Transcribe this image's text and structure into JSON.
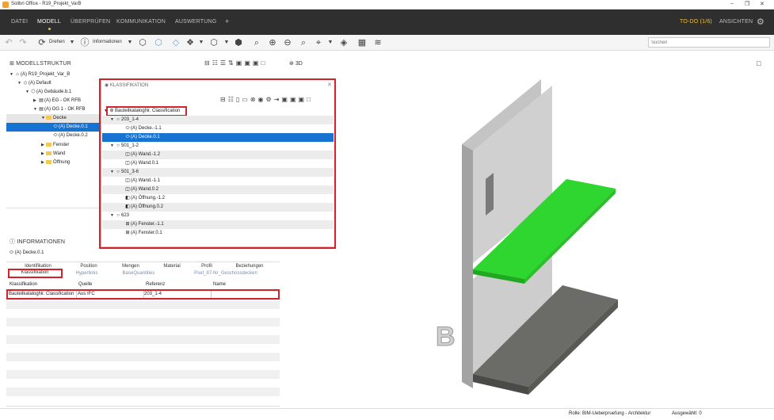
{
  "window": {
    "title": "Solibri Office - R19_Projekt_VarB"
  },
  "menu": {
    "items": [
      "DATEI",
      "MODELL",
      "ÜBERPRÜFEN",
      "KOMMUNIKATION",
      "AUSWERTUNG"
    ],
    "add": "+",
    "todo": "TO-DO (1/6)",
    "ansichten": "ANSICHTEN"
  },
  "toolbar": {
    "drehen": "Drehen",
    "informationen": "Informationen",
    "search_placeholder": "Suchen"
  },
  "modellstruktur": {
    "title": "MODELLSTRUKTUR",
    "tree": [
      "(A) R19_Projekt_Var_B",
      "(A) Default",
      "(A) Gebäude.b.1",
      "(A) EG - OK RFB",
      "(A) OG 1 - OK RFB",
      "Decke",
      "(A) Decke.0.1",
      "(A) Decke.0.2",
      "Fenster",
      "Wand",
      "Öffnung"
    ]
  },
  "informationen": {
    "title": "INFORMATIONEN",
    "object": "(A) Decke.0.1",
    "tabs_row1": [
      "Identifikation",
      "Position",
      "Mengen",
      "Material",
      "Profil",
      "Beziehungen"
    ],
    "tabs_row2": [
      "Klassifikation",
      "Hyperlinks",
      "BaseQuantities",
      "Pset_87-Nr_Geschossdecken"
    ],
    "columns": [
      "Klassifikation",
      "Quelle",
      "Referenz",
      "Name"
    ],
    "rows": [
      [
        "BauteilkatalogNr. Classification",
        "Aus IFC",
        "203_1-4",
        ""
      ]
    ]
  },
  "klassifikation": {
    "title": "KLASSIFIKATION",
    "root": "BauteilkatalogNr. Classification",
    "tree": [
      "203_1-4",
      "(A) Decke.-1.1",
      "(A) Decke.0.1",
      "501_1-2",
      "(A) Wand.-1.2",
      "(A) Wand.0.1",
      "501_3-6",
      "(A) Wand.-1.1",
      "(A) Wand.0.2",
      "(A) Öffnung.-1.2",
      "(A) Öffnung.0.2",
      "623",
      "(A) Fenster.-1.1",
      "(A) Fenster.0.1"
    ]
  },
  "view3d": {
    "label": "3D",
    "letter": "B"
  },
  "status": {
    "role": "Rolle: BIM-Ueberpruefung - Architektur",
    "selected": "Ausgewählt: 0"
  },
  "colors": {
    "menubar": "#2f2f2f",
    "accent": "#f5c02a",
    "selection": "#1673d1",
    "highlight": "#d6212b",
    "slab_green": "#2fd62f"
  }
}
